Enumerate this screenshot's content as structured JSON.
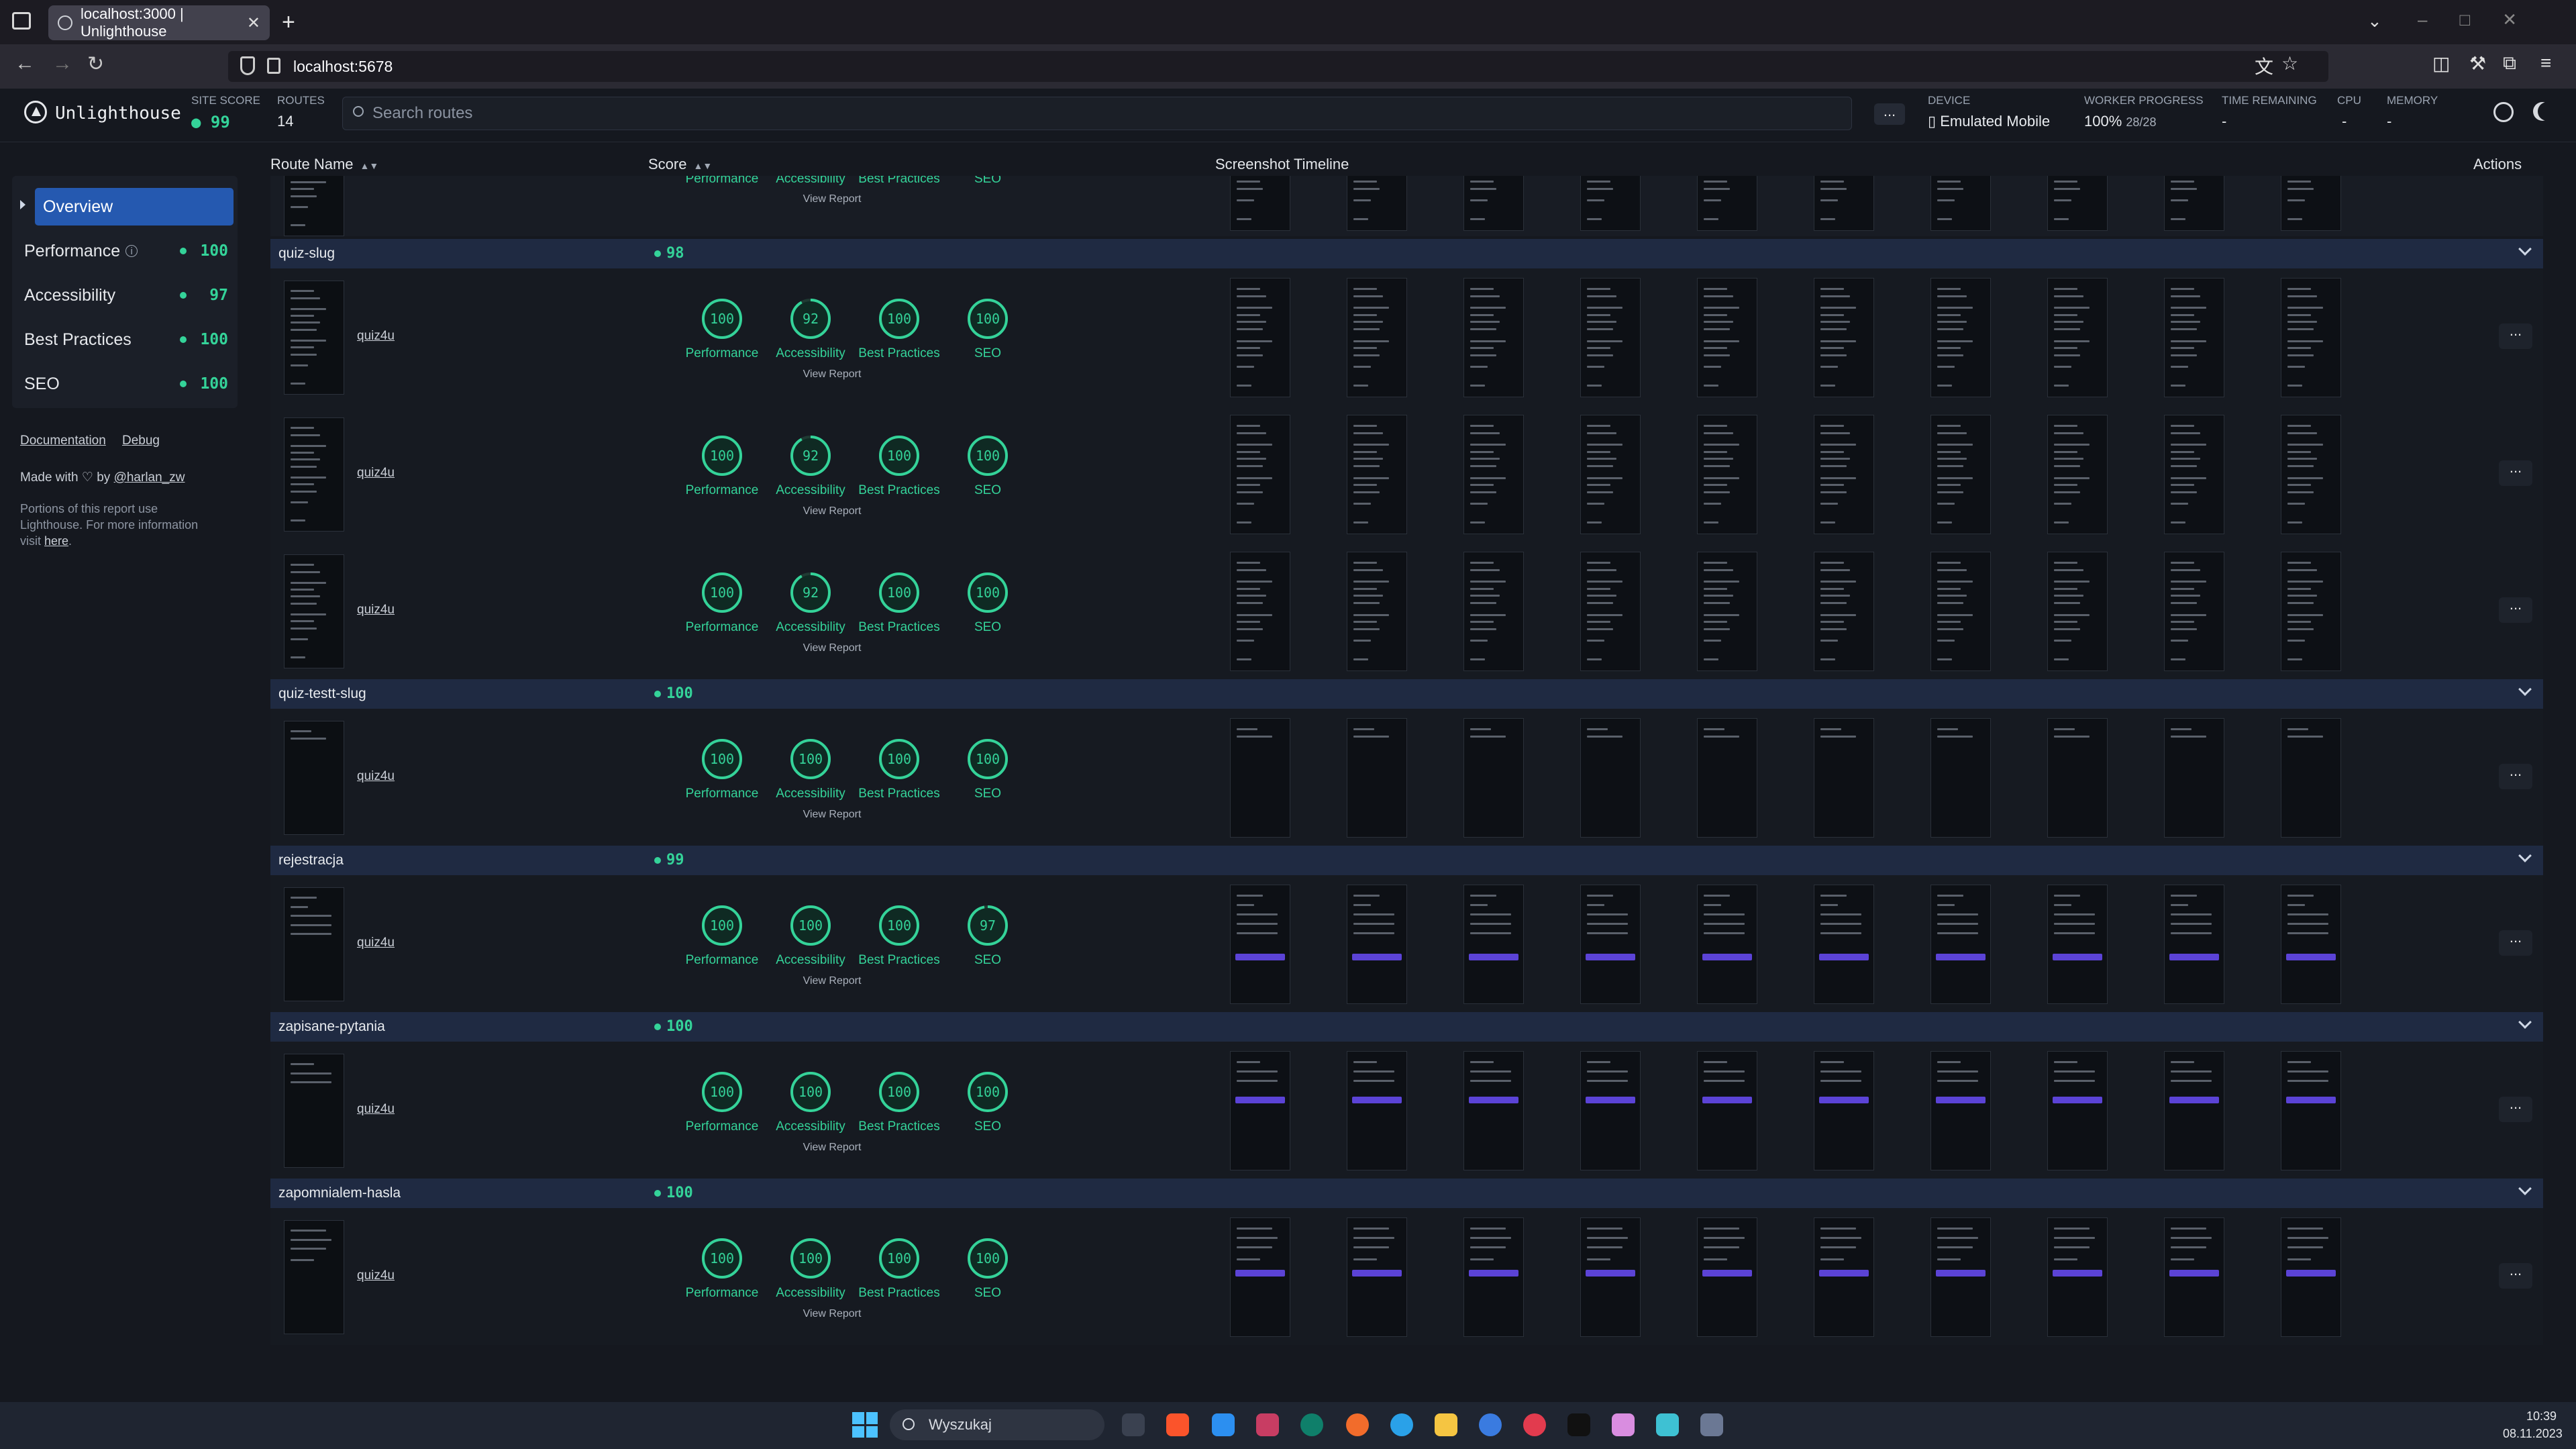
{
  "browser": {
    "tab_title": "localhost:3000 | Unlighthouse",
    "url": "localhost:5678"
  },
  "app": {
    "brand": "Unlighthouse",
    "site_score_label": "SITE SCORE",
    "site_score": "99",
    "routes_label": "ROUTES",
    "routes": "14",
    "search_placeholder": "Search routes",
    "more_label": "...",
    "device_label": "DEVICE",
    "device": "Emulated Mobile",
    "worker_label": "WORKER PROGRESS",
    "worker_pct": "100%",
    "worker_count": "28/28",
    "time_label": "TIME REMAINING",
    "time_value": "-",
    "cpu_label": "CPU",
    "cpu_value": "-",
    "memory_label": "MEMORY",
    "memory_value": "-"
  },
  "sidebar": {
    "overview": "Overview",
    "items": [
      {
        "label": "Performance",
        "score": "100"
      },
      {
        "label": "Accessibility",
        "score": "97"
      },
      {
        "label": "Best Practices",
        "score": "100"
      },
      {
        "label": "SEO",
        "score": "100"
      }
    ],
    "documentation": "Documentation",
    "debug": "Debug",
    "made_with": "Made with",
    "by": "by",
    "author": "@harlan_zw",
    "portions": "Portions of this report use Lighthouse. For more information visit",
    "here": "here"
  },
  "table": {
    "col_route": "Route Name",
    "col_score": "Score",
    "col_timeline": "Screenshot Timeline",
    "col_actions": "Actions",
    "view_report": "View Report"
  },
  "categories": [
    "Performance",
    "Accessibility",
    "Best Practices",
    "SEO"
  ],
  "groups": [
    {
      "name": "quiz-slug",
      "score": "98",
      "rows": [
        {
          "route": "quiz4u",
          "scores": [
            100,
            92,
            100,
            100
          ],
          "shot": "list"
        },
        {
          "route": "quiz4u",
          "scores": [
            100,
            92,
            100,
            100
          ],
          "shot": "list"
        },
        {
          "route": "quiz4u",
          "scores": [
            100,
            92,
            100,
            100
          ],
          "shot": "list"
        }
      ]
    },
    {
      "name": "quiz-testt-slug",
      "score": "100",
      "rows": [
        {
          "route": "quiz4u",
          "scores": [
            100,
            100,
            100,
            100
          ],
          "shot": "empty"
        }
      ]
    },
    {
      "name": "rejestracja",
      "score": "99",
      "rows": [
        {
          "route": "quiz4u",
          "scores": [
            100,
            100,
            100,
            97
          ],
          "shot": "form"
        }
      ]
    },
    {
      "name": "zapisane-pytania",
      "score": "100",
      "rows": [
        {
          "route": "quiz4u",
          "scores": [
            100,
            100,
            100,
            100
          ],
          "shot": "login"
        }
      ]
    },
    {
      "name": "zapomnialem-hasla",
      "score": "100",
      "rows": [
        {
          "route": "quiz4u",
          "scores": [
            100,
            100,
            100,
            100
          ],
          "shot": "forgot"
        }
      ]
    }
  ],
  "partial_row": {
    "labels": [
      "Performance",
      "Accessibility",
      "Best Practices",
      "SEO"
    ]
  },
  "taskbar": {
    "search": "Wyszukaj",
    "time": "10:39",
    "date": "08.11.2023"
  },
  "colors": {
    "accent": "#34d399",
    "warn": "#34d399",
    "selected": "#2559b0",
    "group": "#1f2a42"
  }
}
